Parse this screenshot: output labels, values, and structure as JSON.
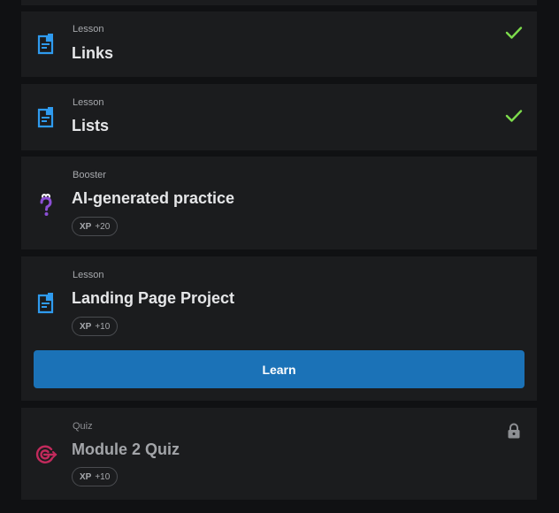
{
  "items": [
    {
      "type_label": "Lesson",
      "title": "Links",
      "icon": "lesson-document-icon",
      "status": "completed"
    },
    {
      "type_label": "Lesson",
      "title": "Lists",
      "icon": "lesson-document-icon",
      "status": "completed"
    },
    {
      "type_label": "Booster",
      "title": "AI-generated practice",
      "icon": "question-mark-icon",
      "xp_label": "XP",
      "xp_value": "+20"
    },
    {
      "type_label": "Lesson",
      "title": "Landing Page Project",
      "icon": "lesson-document-icon",
      "xp_label": "XP",
      "xp_value": "+10",
      "button_label": "Learn"
    },
    {
      "type_label": "Quiz",
      "title": "Module 2 Quiz",
      "icon": "target-icon",
      "xp_label": "XP",
      "xp_value": "+10",
      "status": "locked"
    }
  ],
  "colors": {
    "accent_blue": "#1b72b7",
    "lesson_icon": "#2f9bef",
    "check_green": "#7ddc4c",
    "booster_icon": "#8c4fd6",
    "quiz_icon": "#c22a5c",
    "card_bg": "#1b1c1e",
    "page_bg": "#101113"
  }
}
